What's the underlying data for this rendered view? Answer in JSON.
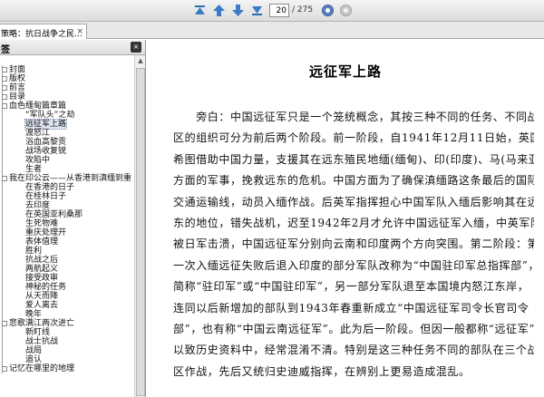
{
  "toolbar": {
    "page_number": "20",
    "page_total": "/ 275",
    "buttons": [
      "first-page",
      "previous-page",
      "next-page",
      "last-page",
      "go",
      "stop"
    ]
  },
  "tab": {
    "title": "策略：抗日战争之民...",
    "close_label": "×"
  },
  "sidebar": {
    "header_label": "签",
    "close_label": "×",
    "items": [
      {
        "label": "封面",
        "depth": 0
      },
      {
        "label": "版权",
        "depth": 0
      },
      {
        "label": "前言",
        "depth": 0
      },
      {
        "label": "目录",
        "depth": 0
      },
      {
        "label": "血色缅甸篇章篇",
        "depth": 0
      },
      {
        "label": "“军队头”之劫",
        "depth": 1
      },
      {
        "label": "远征军上路",
        "depth": 1,
        "selected": true
      },
      {
        "label": "渡怒江",
        "depth": 1
      },
      {
        "label": "浴血高黎贡",
        "depth": 1
      },
      {
        "label": "战场收复锐",
        "depth": 1
      },
      {
        "label": "攻陷中",
        "depth": 1
      },
      {
        "label": "生者",
        "depth": 1
      },
      {
        "label": "我在印公云——从香港到滇缅到重",
        "depth": 0
      },
      {
        "label": "在香港的日子",
        "depth": 1
      },
      {
        "label": "在桂林日子",
        "depth": 1
      },
      {
        "label": "去印度",
        "depth": 1
      },
      {
        "label": "在英国亚利桑那",
        "depth": 1
      },
      {
        "label": "生死物难",
        "depth": 1
      },
      {
        "label": "重庆处理开",
        "depth": 1
      },
      {
        "label": "表体值理",
        "depth": 1
      },
      {
        "label": "胜利",
        "depth": 1
      },
      {
        "label": "抗战之后",
        "depth": 1
      },
      {
        "label": "两航起义",
        "depth": 1
      },
      {
        "label": "接受政审",
        "depth": 1
      },
      {
        "label": "神秘的任务",
        "depth": 1
      },
      {
        "label": "从天而降",
        "depth": 1
      },
      {
        "label": "爱人离去",
        "depth": 1
      },
      {
        "label": "晚年",
        "depth": 1
      },
      {
        "label": "悲歌满江两次进亡",
        "depth": 0
      },
      {
        "label": "新盯线",
        "depth": 1
      },
      {
        "label": "战士抗战",
        "depth": 1
      },
      {
        "label": "战局",
        "depth": 1
      },
      {
        "label": "追认",
        "depth": 1
      },
      {
        "label": "记忆在哪里的地理",
        "depth": 0
      }
    ]
  },
  "document": {
    "title": "远征军上路",
    "lines": [
      "　　旁白：中国远征军只是一个笼统概念，其按三种不同的任务、不同战",
      "区的组织可分为前后两个阶段。前一阶段，自1941年12月11日始，英国",
      "希图借助中国力量，支援其在远东殖民地缅(缅甸)、印(印度)、马(马来亚)",
      "方面的军事，挽救远东的危机。中国方面为了确保滇缅路这条最后的国际",
      "交通运输线，动员入缅作战。后英军指挥担心中国军队入缅后影响其在远",
      "东的地位，错失战机，迟至1942年2月才允许中国远征军入缅，中英军队",
      "被日军击溃，中国远征军分别向云南和印度两个方向突围。第二阶段：第",
      "一次入缅远征失败后退入印度的部分军队改称为“中国驻印军总指挥部”，",
      "简称“驻印军”或“中国驻印军”，另一部分军队退至本国境内怒江东岸，",
      "连同以后新增加的部队到1943年春重新成立“中国远征军司令长官司令",
      "部”，也有称“中国云南远征军”。此为后一阶段。但因一般都称“远征军”，",
      "以致历史资料中，经常混淆不清。特别是这三种任务不同的部队在三个战",
      "区作战，先后又统归史迪威指挥，在辨别上更易造成混乱。"
    ]
  }
}
